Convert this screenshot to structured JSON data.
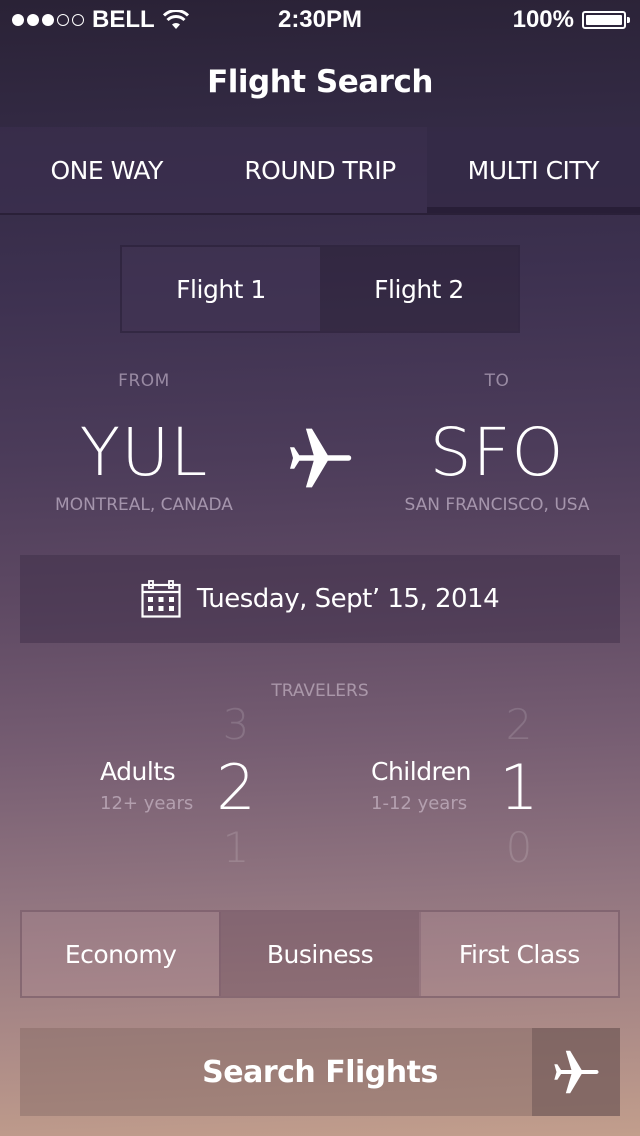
{
  "status_bar": {
    "signal_strength": 3,
    "signal_max": 5,
    "carrier": "BELL",
    "wifi_icon": "wifi-icon",
    "time": "2:30PM",
    "battery_percent": "100%",
    "battery_level": 1.0
  },
  "header": {
    "title": "Flight Search"
  },
  "trip_tabs": [
    {
      "label": "ONE WAY",
      "active": false
    },
    {
      "label": "ROUND TRIP",
      "active": false
    },
    {
      "label": "MULTI CITY",
      "active": true
    }
  ],
  "flight_tabs": [
    {
      "label": "Flight 1",
      "active": true
    },
    {
      "label": "Flight 2",
      "active": false
    }
  ],
  "route": {
    "from_label": "FROM",
    "to_label": "TO",
    "from_code": "YUL",
    "from_city": "MONTREAL, CANADA",
    "to_code": "SFO",
    "to_city": "SAN FRANCISCO, USA",
    "icon": "airplane-icon"
  },
  "date": {
    "icon": "calendar-icon",
    "text": "Tuesday, Sept’ 15, 2014"
  },
  "travelers": {
    "label": "TRAVELERS",
    "adults": {
      "label": "Adults",
      "sublabel": "12+ years",
      "value": "2",
      "above": "3",
      "below": "1"
    },
    "children": {
      "label": "Children",
      "sublabel": "1-12 years",
      "value": "1",
      "above": "2",
      "below": "0"
    }
  },
  "cabin_classes": [
    {
      "label": "Economy",
      "active": false
    },
    {
      "label": "Business",
      "active": true
    },
    {
      "label": "First Class",
      "active": false
    }
  ],
  "search_button": {
    "label": "Search Flights",
    "icon": "airplane-icon"
  }
}
